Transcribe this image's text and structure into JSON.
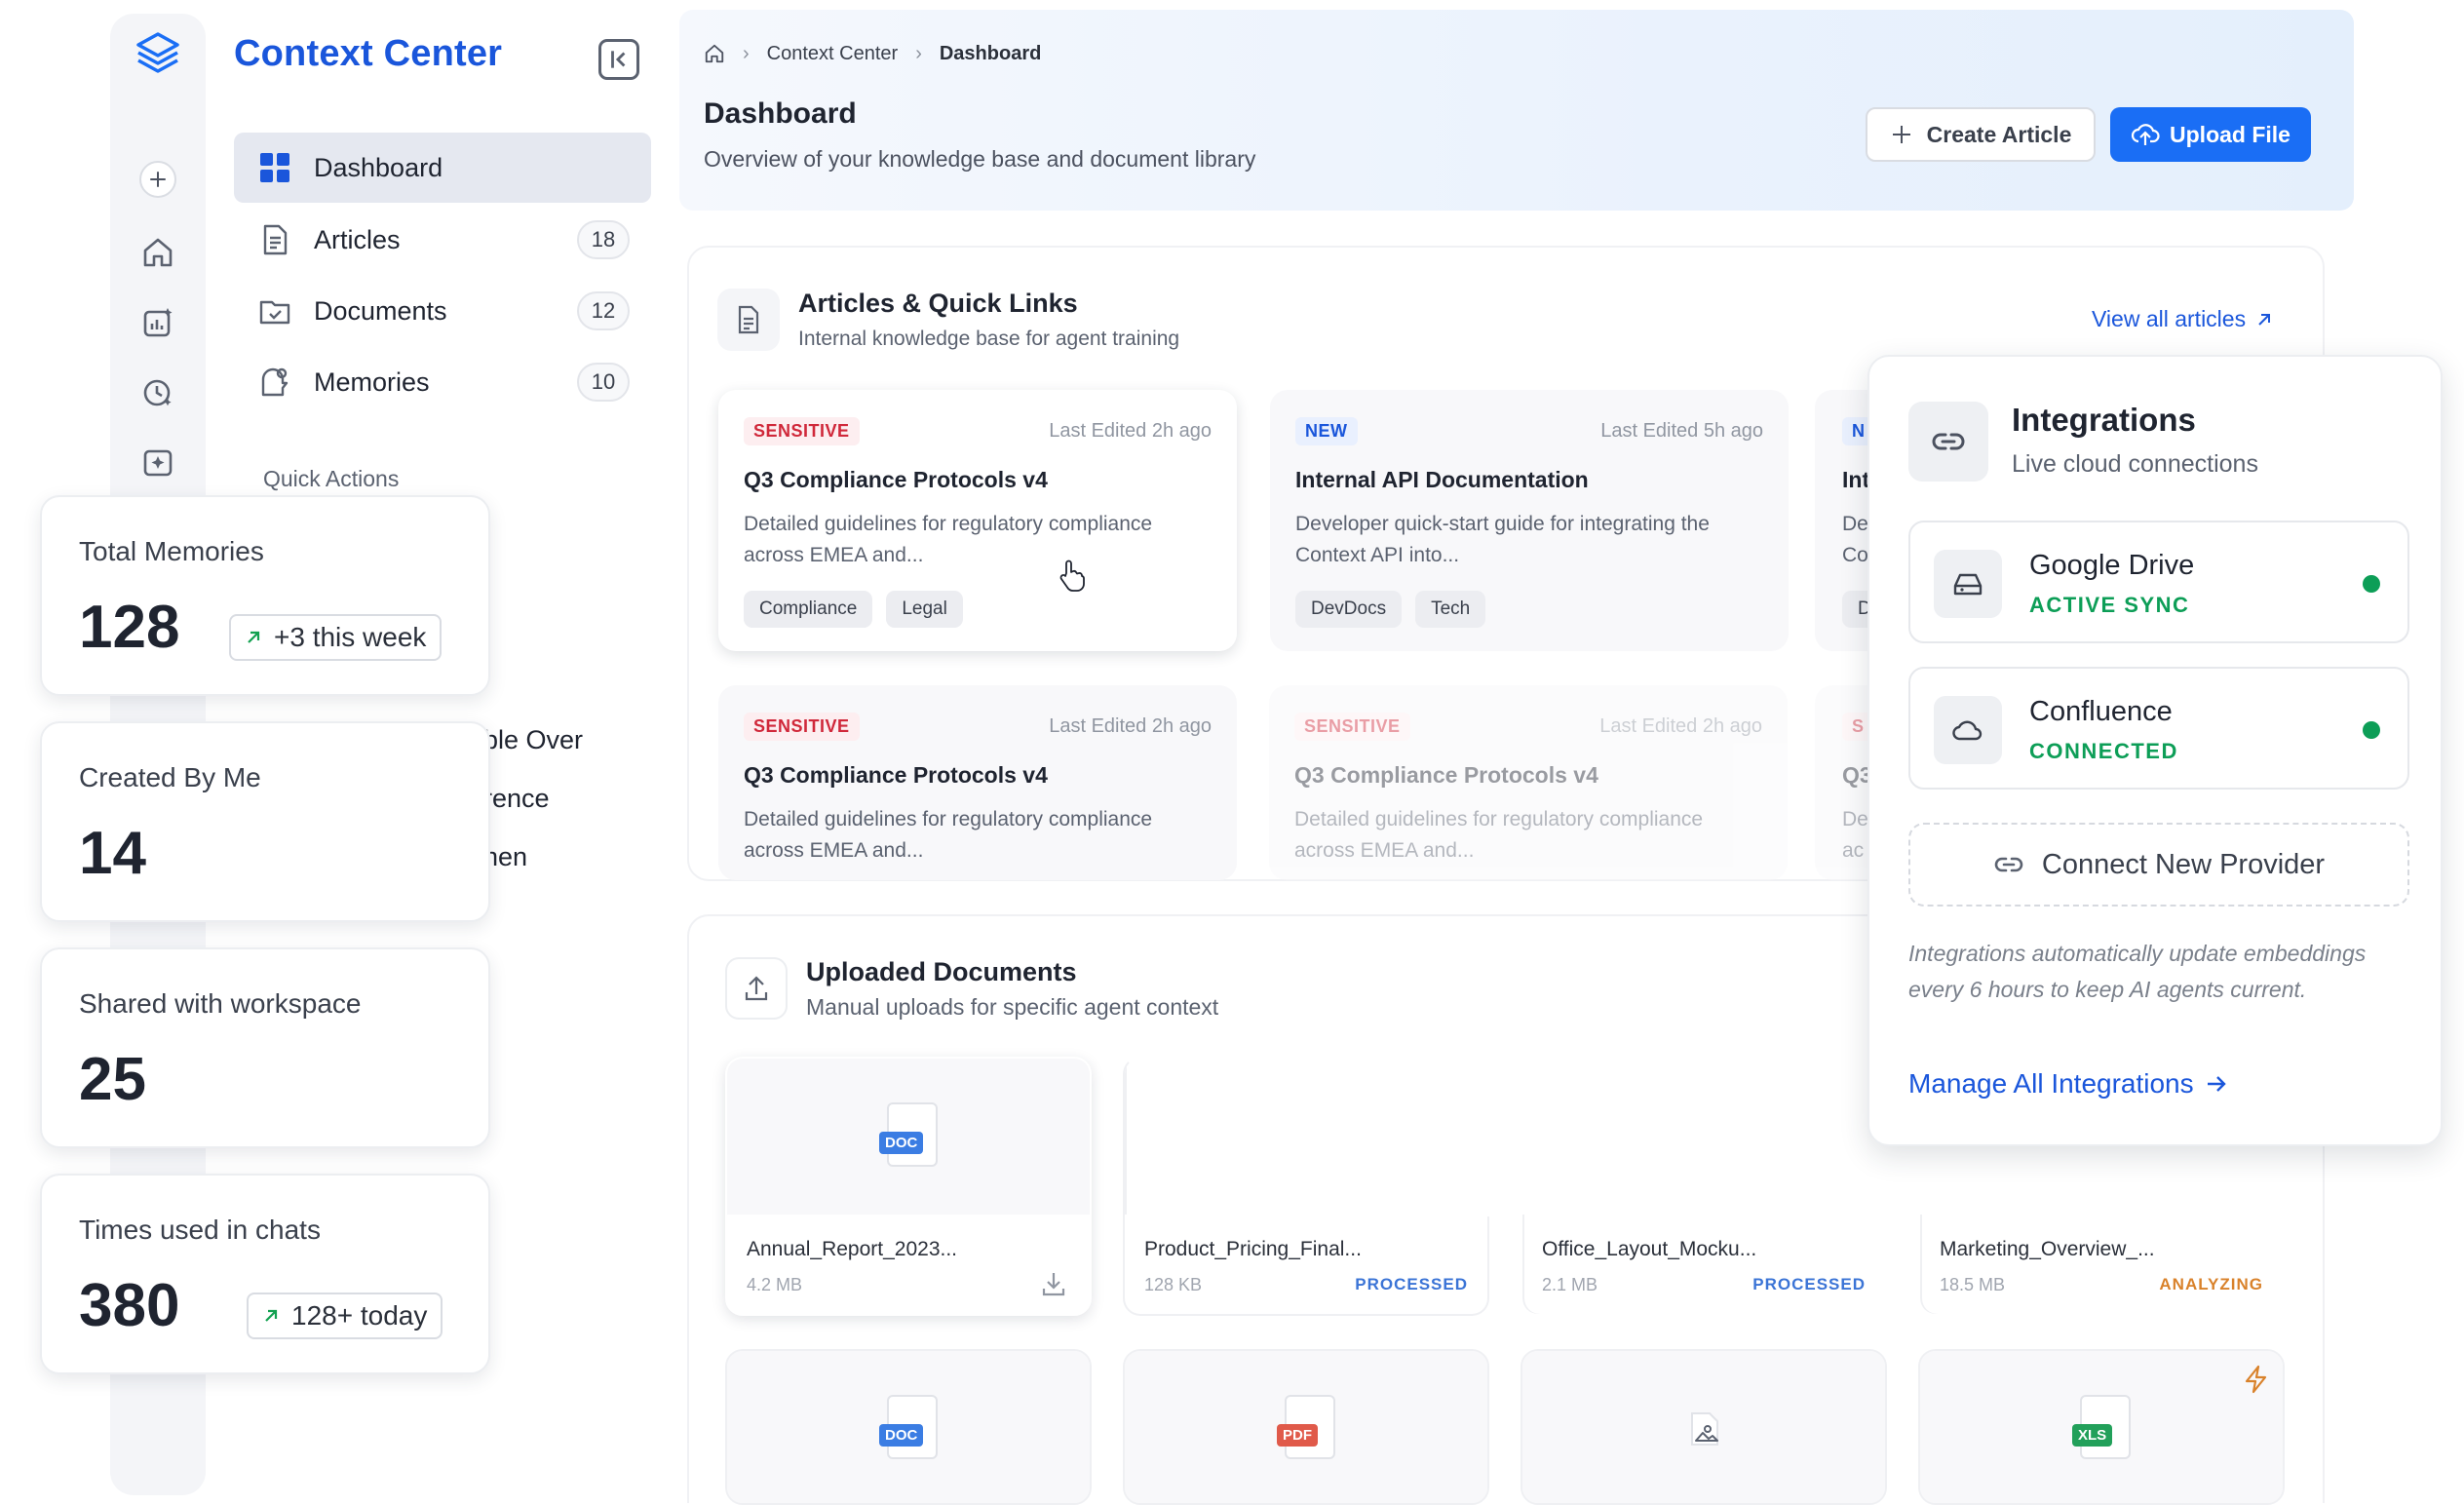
{
  "brand": {
    "name": "Context Center"
  },
  "nav": {
    "items": [
      {
        "label": "Dashboard",
        "icon": "grid-icon",
        "count": null,
        "active": true
      },
      {
        "label": "Articles",
        "icon": "document-icon",
        "count": "18"
      },
      {
        "label": "Documents",
        "icon": "folder-icon",
        "count": "12"
      },
      {
        "label": "Memories",
        "icon": "memory-icon",
        "count": "10"
      }
    ],
    "quick_actions_title": "Quick Actions",
    "quick_actions_partial": [
      "ble Over",
      "rence",
      "nen"
    ]
  },
  "breadcrumb": {
    "items": [
      "Context Center",
      "Dashboard"
    ]
  },
  "header": {
    "title": "Dashboard",
    "subtitle": "Overview of your knowledge base and document library",
    "create_label": "Create Article",
    "upload_label": "Upload File"
  },
  "articles": {
    "title": "Articles & Quick Links",
    "subtitle": "Internal knowledge base for agent training",
    "view_all": "View all articles",
    "cards": [
      {
        "badge": "SENSITIVE",
        "edited": "Last Edited 2h ago",
        "title": "Q3 Compliance Protocols v4",
        "desc1": "Detailed guidelines for regulatory compliance",
        "desc2": "across EMEA and...",
        "tags": [
          "Compliance",
          "Legal"
        ]
      },
      {
        "badge": "NEW",
        "edited": "Last Edited 5h ago",
        "title": "Internal API Documentation",
        "desc1": "Developer quick-start guide for integrating the",
        "desc2": "Context API into...",
        "tags": [
          "DevDocs",
          "Tech"
        ]
      },
      {
        "badge": "N",
        "title": "Int",
        "desc1": "De",
        "desc2": "Co",
        "tag": "D"
      },
      {
        "badge": "SENSITIVE",
        "edited": "Last Edited 2h ago",
        "title": "Q3 Compliance Protocols v4",
        "desc1": "Detailed guidelines for regulatory compliance",
        "desc2": "across EMEA and..."
      },
      {
        "badge": "SENSITIVE",
        "edited": "Last Edited 2h ago",
        "title": "Q3 Compliance Protocols v4",
        "desc1": "Detailed guidelines for regulatory compliance",
        "desc2": "across EMEA and..."
      },
      {
        "badge": "S",
        "title": "Q3",
        "desc1": "De",
        "desc2": "ac"
      }
    ]
  },
  "documents": {
    "title": "Uploaded Documents",
    "subtitle": "Manual uploads for specific agent context",
    "files": [
      {
        "name": "Annual_Report_2023...",
        "size": "4.2 MB",
        "type": "DOC",
        "status": ""
      },
      {
        "name": "Product_Pricing_Final...",
        "size": "128 KB",
        "type": "",
        "status": "PROCESSED"
      },
      {
        "name": "Office_Layout_Mocku...",
        "size": "2.1 MB",
        "type": "",
        "status": "PROCESSED"
      },
      {
        "name": "Marketing_Overview_...",
        "size": "18.5 MB",
        "type": "",
        "status": "ANALYZING"
      },
      {
        "type": "DOC"
      },
      {
        "type": "PDF"
      },
      {
        "type": "IMG"
      },
      {
        "type": "XLS"
      }
    ],
    "colors": {
      "processed": "#3b74d6",
      "analyzing": "#d9822b",
      "doc": "#3b7de3",
      "pdf": "#e05a4a",
      "xls": "#22a05a"
    }
  },
  "stats": [
    {
      "label": "Total Memories",
      "value": "128",
      "delta": "+3 this week"
    },
    {
      "label": "Created By Me",
      "value": "14"
    },
    {
      "label": "Shared with workspace",
      "value": "25"
    },
    {
      "label": "Times used in chats",
      "value": "380",
      "delta": "128+ today"
    }
  ],
  "integrations": {
    "title": "Integrations",
    "subtitle": "Live cloud connections",
    "providers": [
      {
        "name": "Google Drive",
        "status": "ACTIVE SYNC",
        "icon": "drive-icon"
      },
      {
        "name": "Confluence",
        "status": "CONNECTED",
        "icon": "cloud-icon"
      }
    ],
    "connect_label": "Connect New Provider",
    "note": "Integrations automatically update embeddings every 6 hours to keep AI agents current.",
    "manage_label": "Manage All Integrations"
  },
  "colors": {
    "brand": "#1a56db",
    "primary_button": "#1a6ef5",
    "success": "#0d9e57",
    "danger": "#d0283a"
  }
}
